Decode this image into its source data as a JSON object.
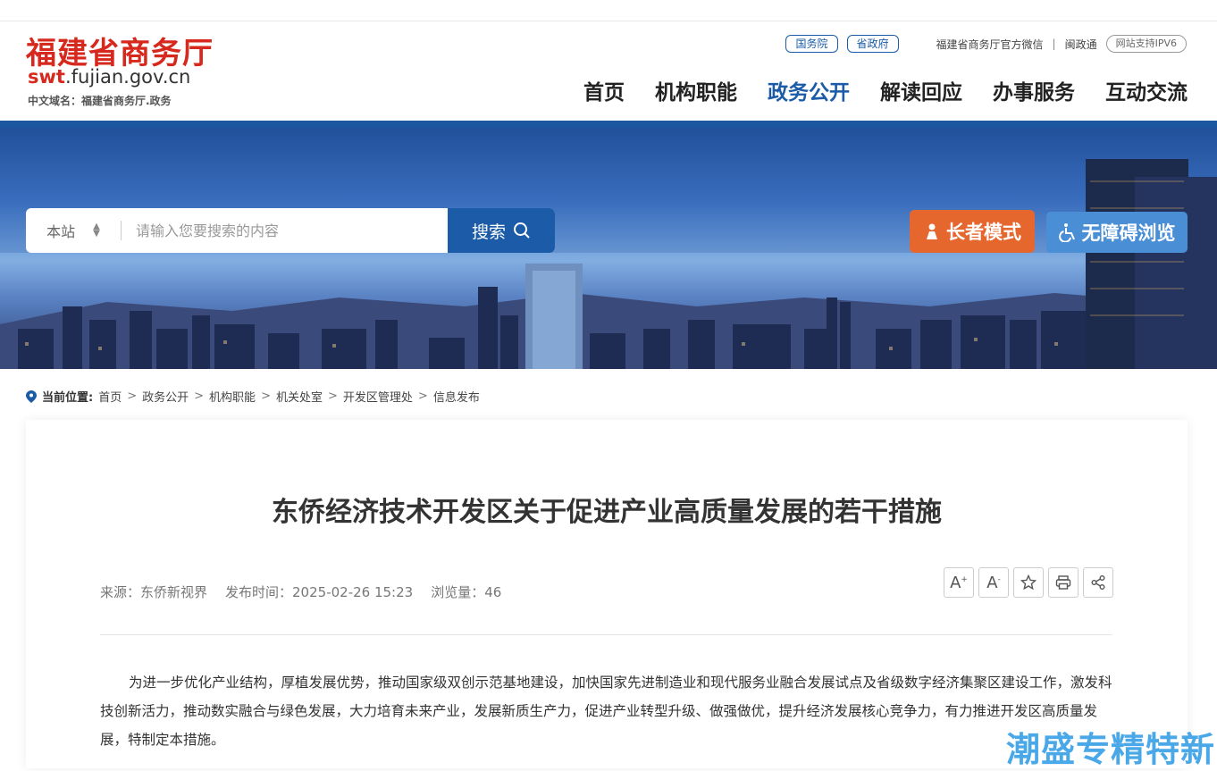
{
  "header": {
    "logo_cn": "福建省商务厅",
    "logo_en_prefix": "swt",
    "logo_en_suffix": ".fujian.gov.cn",
    "domain_cn": "中文域名：福建省商务厅.政务",
    "links": [
      "国务院",
      "省政府"
    ],
    "wechat": "福建省商务厅官方微信",
    "divider": "|",
    "minzhengtong": "闽政通",
    "ipv6": "网站支持IPV6",
    "nav": [
      "首页",
      "机构职能",
      "政务公开",
      "解读回应",
      "办事服务",
      "互动交流"
    ],
    "nav_active_index": 2
  },
  "banner": {
    "search_scope": "本站",
    "search_placeholder": "请输入您要搜索的内容",
    "search_button": "搜索",
    "elder_mode": "长者模式",
    "accessible": "无障碍浏览"
  },
  "breadcrumb": {
    "label": "当前位置:",
    "items": [
      "首页",
      "政务公开",
      "机构职能",
      "机关处室",
      "开发区管理处",
      "信息发布"
    ]
  },
  "article": {
    "title": "东侨经济技术开发区关于促进产业高质量发展的若干措施",
    "source": "来源：东侨新视界",
    "published": "发布时间：2025-02-26 15:23",
    "views": "浏览量：46",
    "tools": [
      "A+",
      "A-",
      "收藏",
      "打印",
      "分享"
    ],
    "paragraph": "为进一步优化产业结构，厚植发展优势，推动国家级双创示范基地建设，加快国家先进制造业和现代服务业融合发展试点及省级数字经济集聚区建设工作，激发科技创新活力，推动数实融合与绿色发展，大力培育未来产业，发展新质生产力，促进产业转型升级、做强做优，提升经济发展核心竞争力，有力推进开发区高质量发展，特制定本措施。"
  },
  "watermark": "潮盛专精特新",
  "colors": {
    "brand_red": "#d7281e",
    "brand_blue": "#1b5ba8",
    "elder_orange": "#e5672e",
    "access_blue": "#4a8fd6"
  }
}
